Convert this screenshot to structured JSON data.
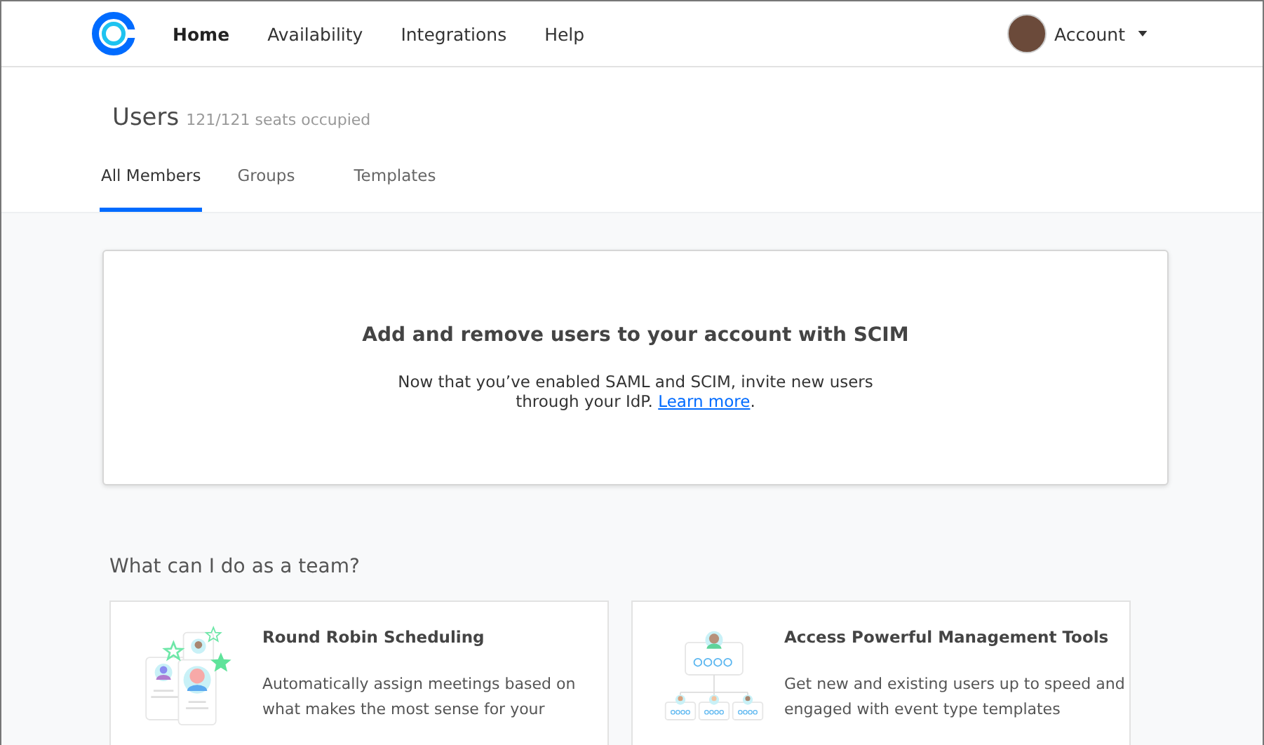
{
  "nav": {
    "items": [
      {
        "label": "Home",
        "selected": true
      },
      {
        "label": "Availability",
        "selected": false
      },
      {
        "label": "Integrations",
        "selected": false
      },
      {
        "label": "Help",
        "selected": false
      }
    ],
    "account": "Account"
  },
  "header": {
    "title": "Users",
    "subtitle": "121/121 seats occupied"
  },
  "tabs": [
    {
      "label": "All Members",
      "selected": true
    },
    {
      "label": "Groups",
      "selected": false
    },
    {
      "label": "Templates",
      "selected": false
    }
  ],
  "notice": {
    "title": "Add and remove users to your account with SCIM",
    "text": "Now that you’ve enabled SAML and SCIM, invite new users through your IdP.",
    "link": "Learn more",
    "after": "."
  },
  "section_title": "What can I do as a team?",
  "features": [
    {
      "kind": "round-robin",
      "title": "Round Robin Scheduling",
      "text": "Automatically assign meetings based on what makes the most sense for your"
    },
    {
      "kind": "management",
      "title": "Access Powerful Management Tools",
      "text": "Get new and existing users up to speed and engaged with event type templates"
    }
  ]
}
